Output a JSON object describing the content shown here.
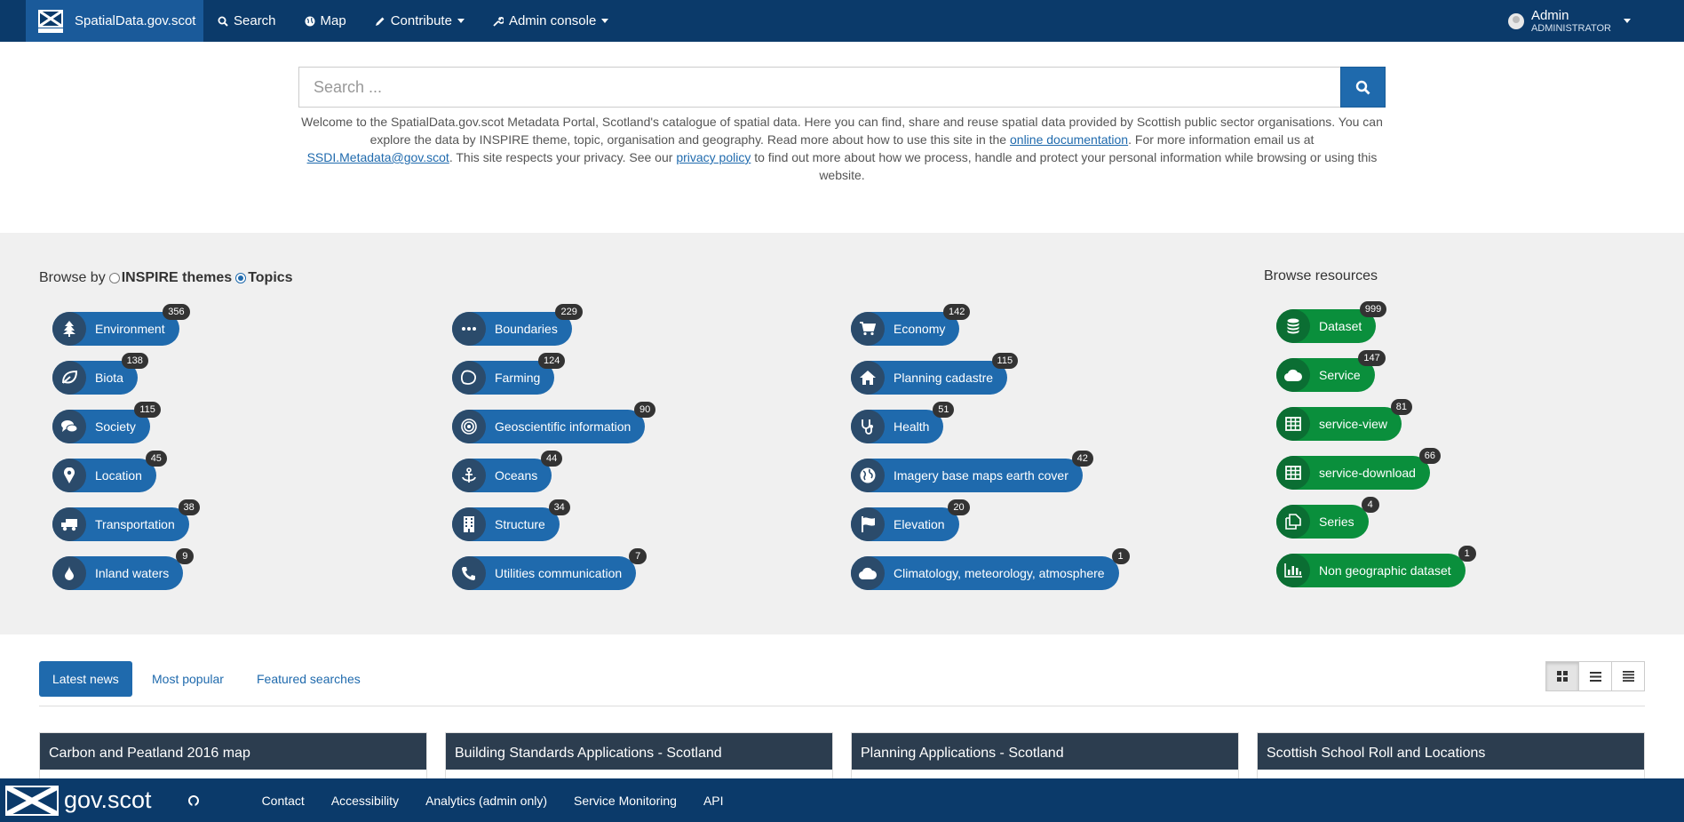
{
  "topnav": {
    "brand": "SpatialData.gov.scot",
    "items": [
      {
        "label": "Search",
        "icon": "search-icon"
      },
      {
        "label": "Map",
        "icon": "globe-icon"
      },
      {
        "label": "Contribute",
        "icon": "pencil-icon"
      },
      {
        "label": "Admin console",
        "icon": "wrench-icon"
      }
    ],
    "user": {
      "name": "Admin",
      "role": "ADMINISTRATOR"
    }
  },
  "search": {
    "placeholder": "Search ..."
  },
  "intro": {
    "t1": "Welcome to the SpatialData.gov.scot Metadata Portal, Scotland's catalogue of spatial data. Here you can find, share and reuse spatial data provided by Scottish public sector organisations. You can explore the data by INSPIRE theme, topic, organisation and geography. Read more about how to use this site in the ",
    "link1": "online documentation",
    "t2": ". For more information email us at ",
    "link2": "SSDI.Metadata@gov.scot",
    "t3": ". This site respects your privacy. See our ",
    "link3": "privacy policy",
    "t4": " to find out more about how we process, handle and protect your personal information while browsing or using this website."
  },
  "browse": {
    "label": "Browse by",
    "opt1": "INSPIRE themes",
    "opt2": "Topics",
    "resources_title": "Browse resources",
    "topics": [
      {
        "label": "Environment",
        "count": "356"
      },
      {
        "label": "Biota",
        "count": "138"
      },
      {
        "label": "Society",
        "count": "115"
      },
      {
        "label": "Location",
        "count": "45"
      },
      {
        "label": "Transportation",
        "count": "38"
      },
      {
        "label": "Inland waters",
        "count": "9"
      },
      {
        "label": "Boundaries",
        "count": "229"
      },
      {
        "label": "Farming",
        "count": "124"
      },
      {
        "label": "Geoscientific information",
        "count": "90"
      },
      {
        "label": "Oceans",
        "count": "44"
      },
      {
        "label": "Structure",
        "count": "34"
      },
      {
        "label": "Utilities communication",
        "count": "7"
      },
      {
        "label": "Economy",
        "count": "142"
      },
      {
        "label": "Planning cadastre",
        "count": "115"
      },
      {
        "label": "Health",
        "count": "51"
      },
      {
        "label": "Imagery base maps earth cover",
        "count": "42"
      },
      {
        "label": "Elevation",
        "count": "20"
      },
      {
        "label": "Climatology, meteorology, atmosphere",
        "count": "1"
      }
    ],
    "resources": [
      {
        "label": "Dataset",
        "count": "999"
      },
      {
        "label": "Service",
        "count": "147"
      },
      {
        "label": "service-view",
        "count": "81"
      },
      {
        "label": "service-download",
        "count": "66"
      },
      {
        "label": "Series",
        "count": "4"
      },
      {
        "label": "Non geographic dataset",
        "count": "1"
      }
    ]
  },
  "tabs": [
    "Latest news",
    "Most popular",
    "Featured searches"
  ],
  "cards": [
    "Carbon and Peatland 2016 map",
    "Building Standards Applications - Scotland",
    "Planning Applications - Scotland",
    "Scottish School Roll and Locations"
  ],
  "footer": {
    "logo": "gov.scot",
    "links": [
      "Contact",
      "Accessibility",
      "Analytics (admin only)",
      "Service Monitoring",
      "API"
    ]
  },
  "colors": {
    "navbar": "#0b3a6a",
    "primary": "#1f6aad",
    "resource_green": "#0a8f3c",
    "count_badge": "#333333"
  }
}
